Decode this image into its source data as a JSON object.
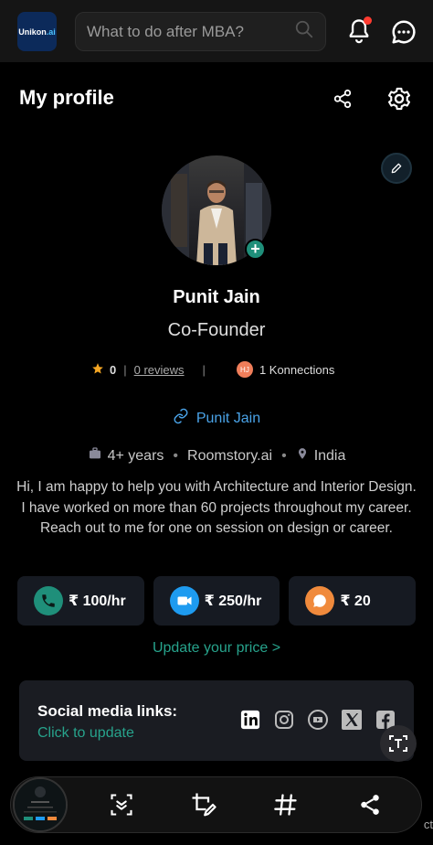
{
  "header": {
    "logo_text": "Unikon",
    "logo_suffix": ".ai",
    "search_placeholder": "What to do after MBA?",
    "icons": [
      "search-icon",
      "bell-icon",
      "chat-icon"
    ]
  },
  "page": {
    "title": "My profile",
    "actions": [
      "share-icon",
      "gear-icon"
    ]
  },
  "profile": {
    "name": "Punit Jain",
    "role": "Co-Founder",
    "rating": "0",
    "reviews": "0 reviews",
    "konnections_avatar": "HJ",
    "konnections": "1 Konnections",
    "link_text": "Punit Jain",
    "experience": "4+ years",
    "company": "Roomstory.ai",
    "location": "India",
    "bio": "Hi, I am happy to help you with Architecture and Interior Design. I have worked on more than 60 projects throughout my career. Reach out to me for one on session on design or career."
  },
  "prices": [
    {
      "icon": "phone-icon",
      "value": "₹ 100/hr",
      "color": "#1f8f7a"
    },
    {
      "icon": "video-icon",
      "value": "₹ 250/hr",
      "color": "#1e9bf0"
    },
    {
      "icon": "message-icon",
      "value": "₹ 20",
      "color": "#f08a3c"
    }
  ],
  "update_price": "Update your price >",
  "social": {
    "label": "Social media links:",
    "cta": "Click to update",
    "icons": [
      "linkedin-icon",
      "instagram-icon",
      "youtube-icon",
      "x-icon",
      "facebook-icon"
    ]
  },
  "bottom_bar": {
    "icons": [
      "screenshot-thumbnail",
      "scroll-capture-icon",
      "crop-edit-icon",
      "hashtag-icon",
      "share-icon"
    ],
    "edge_text": "ct"
  },
  "colors": {
    "accent_teal": "#27a38c",
    "link_blue": "#4aa3e8",
    "star": "#f5a623"
  }
}
